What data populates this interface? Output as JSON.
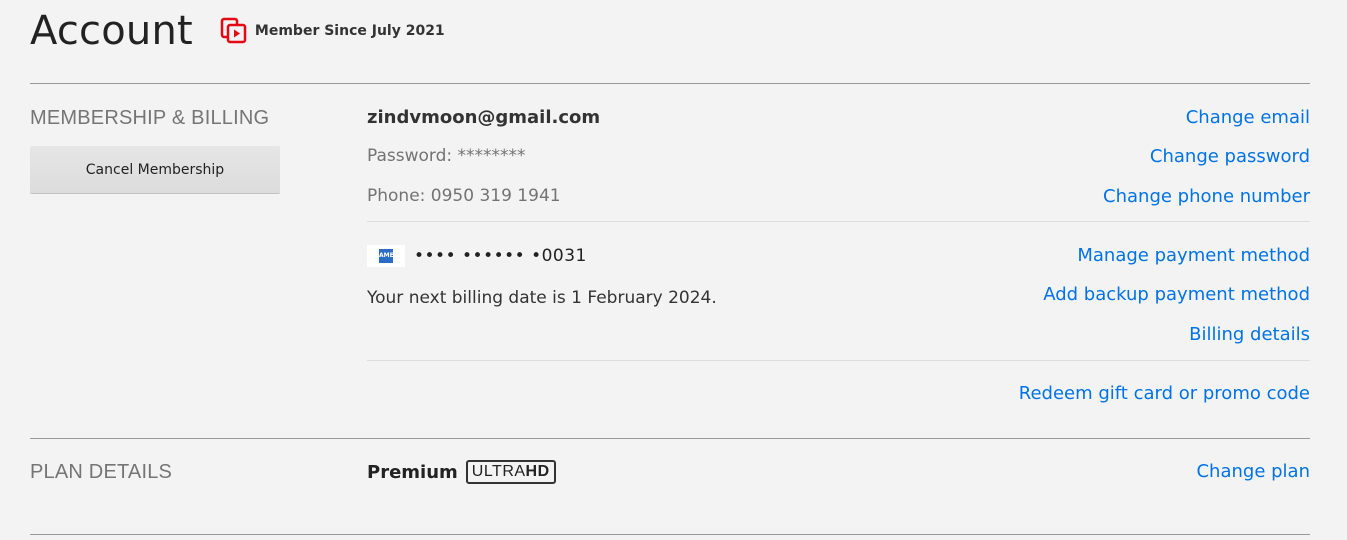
{
  "header": {
    "title": "Account",
    "member_since": "Member Since July 2021"
  },
  "membership": {
    "section_label": "MEMBERSHIP & BILLING",
    "cancel_button_label": "Cancel Membership",
    "email": "zindvmoon@gmail.com",
    "password": "Password: ********",
    "phone": "Phone: 0950 319 1941",
    "change_email": "Change email",
    "change_password": "Change password",
    "change_phone": "Change phone number",
    "card_number": "•••• •••••• •0031",
    "card_logo_text": "AMEX",
    "next_billing": "Your next billing date is 1 February 2024.",
    "manage_payment": "Manage payment method",
    "add_backup_payment": "Add backup payment method",
    "billing_details": "Billing details",
    "redeem": "Redeem gift card or promo code"
  },
  "plan": {
    "section_label": "PLAN DETAILS",
    "plan_name": "Premium",
    "badge_ultra": "ULTRA",
    "badge_hd": "HD",
    "change_plan": "Change plan"
  },
  "colors": {
    "link": "#0073e6",
    "brand_red": "#e50914",
    "background": "#f3f3f3"
  },
  "icons": {
    "member_since": "member-since-icon",
    "card": "amex-card-icon"
  }
}
